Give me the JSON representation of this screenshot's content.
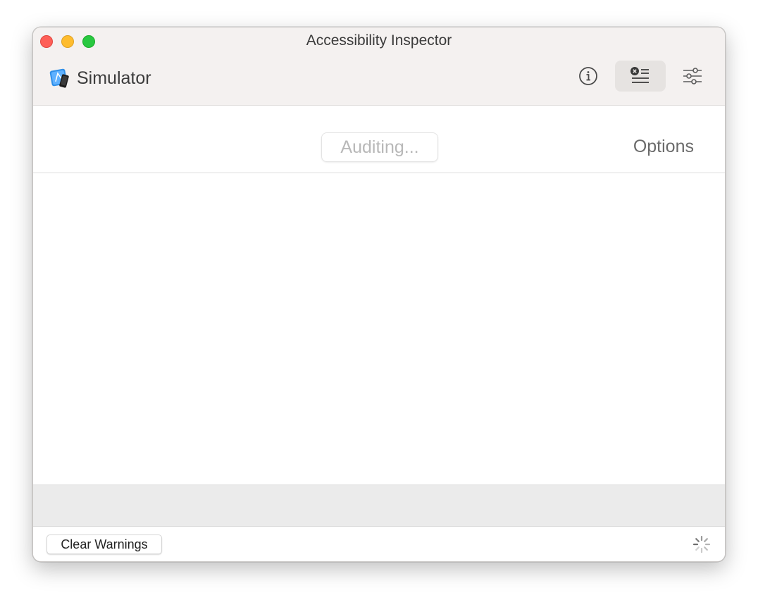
{
  "window": {
    "title": "Accessibility Inspector"
  },
  "toolbar": {
    "target_label": "Simulator",
    "target_icon": "simulator-app-icon",
    "buttons": [
      {
        "name": "inspection-button",
        "icon": "info-circle-icon"
      },
      {
        "name": "audit-button",
        "icon": "audit-list-icon",
        "selected": true
      },
      {
        "name": "settings-button",
        "icon": "sliders-icon"
      }
    ]
  },
  "audit": {
    "run_button_label": "Auditing...",
    "options_label": "Options"
  },
  "footer": {
    "clear_warnings_label": "Clear Warnings"
  },
  "colors": {
    "close": "#fe5f57",
    "minimize": "#febc2e",
    "maximize": "#28c840",
    "toolbar_bg": "#f4f1f0",
    "selected_button_bg": "#e6e3e1"
  }
}
